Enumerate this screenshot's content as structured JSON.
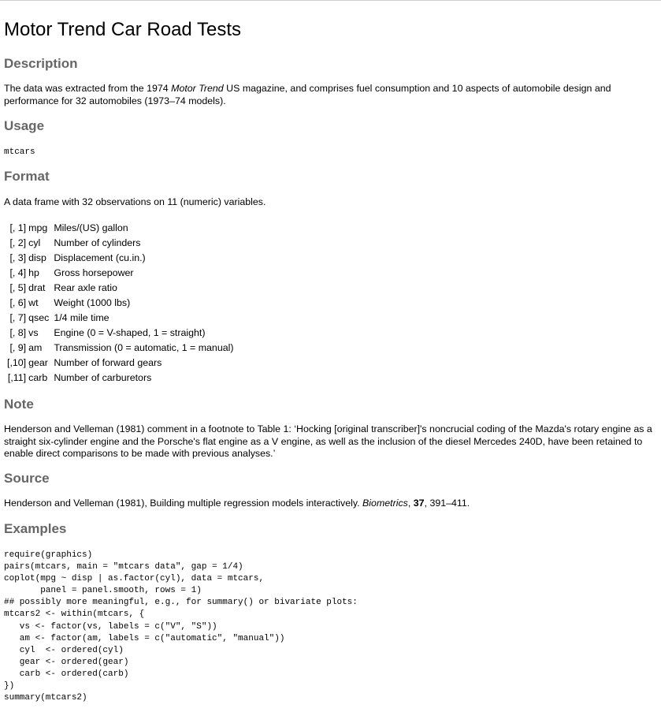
{
  "title": "Motor Trend Car Road Tests",
  "description": {
    "heading": "Description",
    "text_1": "The data was extracted from the 1974 ",
    "text_em": "Motor Trend",
    "text_2": " US magazine, and comprises fuel consumption and 10 aspects of automobile design and performance for 32 automobiles (1973–74 models)."
  },
  "usage": {
    "heading": "Usage",
    "code": "mtcars"
  },
  "format": {
    "heading": "Format",
    "intro": "A data frame with 32 observations on 11 (numeric) variables.",
    "rows": [
      {
        "index": "[, 1]",
        "name": "mpg",
        "desc": "Miles/(US) gallon"
      },
      {
        "index": "[, 2]",
        "name": "cyl",
        "desc": "Number of cylinders"
      },
      {
        "index": "[, 3]",
        "name": "disp",
        "desc": "Displacement (cu.in.)"
      },
      {
        "index": "[, 4]",
        "name": "hp",
        "desc": "Gross horsepower"
      },
      {
        "index": "[, 5]",
        "name": "drat",
        "desc": "Rear axle ratio"
      },
      {
        "index": "[, 6]",
        "name": "wt",
        "desc": "Weight (1000 lbs)"
      },
      {
        "index": "[, 7]",
        "name": "qsec",
        "desc": "1/4 mile time"
      },
      {
        "index": "[, 8]",
        "name": "vs",
        "desc": "Engine (0 = V-shaped, 1 = straight)"
      },
      {
        "index": "[, 9]",
        "name": "am",
        "desc": "Transmission (0 = automatic, 1 = manual)"
      },
      {
        "index": "[,10]",
        "name": "gear",
        "desc": "Number of forward gears"
      },
      {
        "index": "[,11]",
        "name": "carb",
        "desc": "Number of carburetors"
      }
    ]
  },
  "note": {
    "heading": "Note",
    "text": "Henderson and Velleman (1981) comment in a footnote to Table 1: ‘Hocking [original transcriber]'s noncrucial coding of the Mazda's rotary engine as a straight six-cylinder engine and the Porsche's flat engine as a V engine, as well as the inclusion of the diesel Mercedes 240D, have been retained to enable direct comparisons to be made with previous analyses.’"
  },
  "source": {
    "heading": "Source",
    "text_1": "Henderson and Velleman (1981), Building multiple regression models interactively. ",
    "journal": "Biometrics",
    "text_2": ", ",
    "volume": "37",
    "text_3": ", 391–411."
  },
  "examples": {
    "heading": "Examples",
    "code": "require(graphics)\npairs(mtcars, main = \"mtcars data\", gap = 1/4)\ncoplot(mpg ~ disp | as.factor(cyl), data = mtcars,\n       panel = panel.smooth, rows = 1)\n## possibly more meaningful, e.g., for summary() or bivariate plots:\nmtcars2 <- within(mtcars, {\n   vs <- factor(vs, labels = c(\"V\", \"S\"))\n   am <- factor(am, labels = c(\"automatic\", \"manual\"))\n   cyl  <- ordered(cyl)\n   gear <- ordered(gear)\n   carb <- ordered(carb)\n})\nsummary(mtcars2)"
  }
}
